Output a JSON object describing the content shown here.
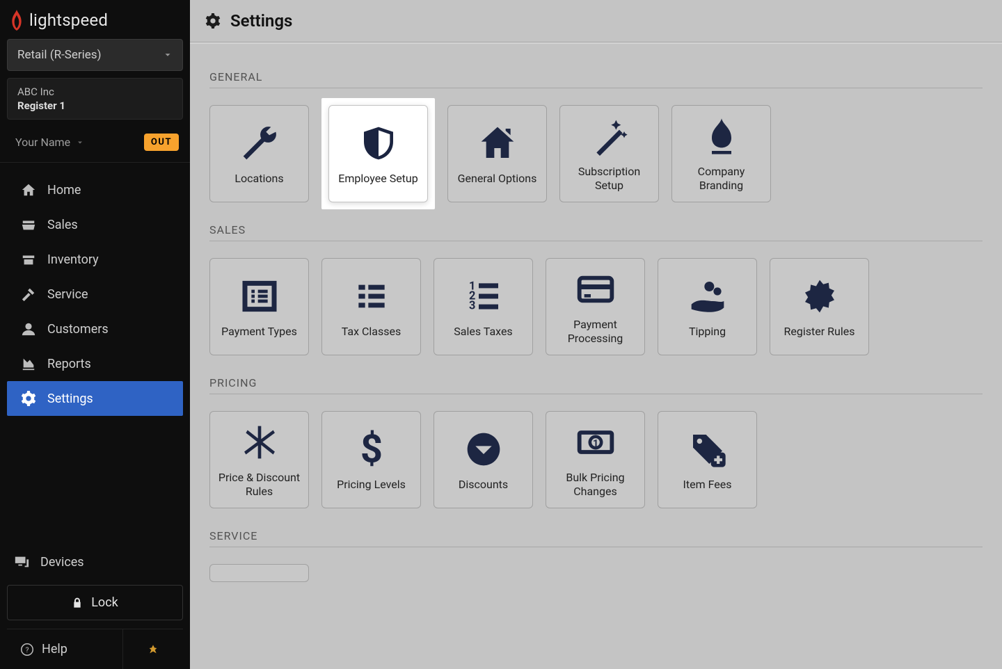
{
  "brand": "lightspeed",
  "product_name": "Retail (R-Series)",
  "company_name": "ABC Inc",
  "register_name": "Register 1",
  "user_name": "Your Name",
  "out_label": "OUT",
  "nav": {
    "home": "Home",
    "sales": "Sales",
    "inventory": "Inventory",
    "service": "Service",
    "customers": "Customers",
    "reports": "Reports",
    "settings": "Settings"
  },
  "devices_label": "Devices",
  "lock_label": "Lock",
  "help_label": "Help",
  "header_title": "Settings",
  "sections": {
    "general": {
      "label": "GENERAL",
      "tiles": [
        "Locations",
        "Employee Setup",
        "General Options",
        "Subscription Setup",
        "Company Branding"
      ]
    },
    "sales": {
      "label": "SALES",
      "tiles": [
        "Payment Types",
        "Tax Classes",
        "Sales Taxes",
        "Payment Processing",
        "Tipping",
        "Register Rules"
      ]
    },
    "pricing": {
      "label": "PRICING",
      "tiles": [
        "Price & Discount Rules",
        "Pricing Levels",
        "Discounts",
        "Bulk Pricing Changes",
        "Item Fees"
      ]
    },
    "service": {
      "label": "SERVICE"
    }
  }
}
